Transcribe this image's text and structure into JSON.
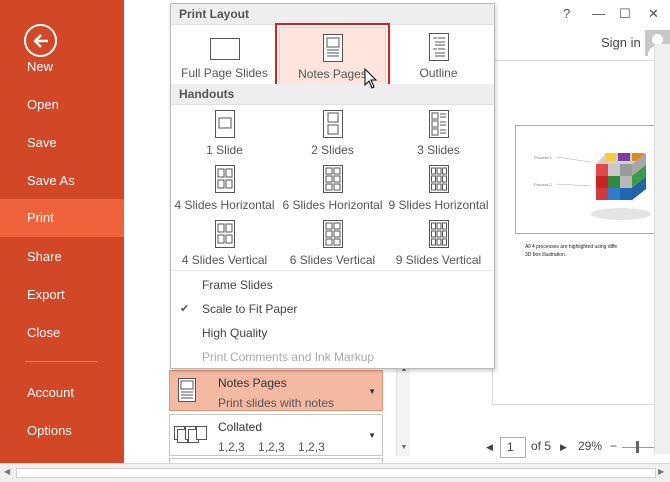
{
  "sidebar": {
    "items": [
      {
        "label": "New"
      },
      {
        "label": "Open"
      },
      {
        "label": "Save"
      },
      {
        "label": "Save As"
      },
      {
        "label": "Print"
      },
      {
        "label": "Share"
      },
      {
        "label": "Export"
      },
      {
        "label": "Close"
      },
      {
        "label": "Account"
      },
      {
        "label": "Options"
      }
    ],
    "active": "Print",
    "accent_color": "#d24726",
    "active_color": "#f0623b"
  },
  "window": {
    "help": "?",
    "minimize": "—",
    "restore": "☐",
    "close": "✕",
    "signin": "Sign in"
  },
  "dropdown": {
    "print_layout_header": "Print Layout",
    "print_layout_options": [
      {
        "label": "Full Page Slides",
        "icon": "full-page-slide-icon"
      },
      {
        "label": "Notes Pages",
        "icon": "notes-pages-icon"
      },
      {
        "label": "Outline",
        "icon": "outline-icon"
      }
    ],
    "handouts_header": "Handouts",
    "handout_options": [
      {
        "label": "1 Slide"
      },
      {
        "label": "2 Slides"
      },
      {
        "label": "3 Slides"
      },
      {
        "label": "4 Slides Horizontal"
      },
      {
        "label": "6 Slides Horizontal"
      },
      {
        "label": "9 Slides Horizontal"
      },
      {
        "label": "4 Slides Vertical"
      },
      {
        "label": "6 Slides Vertical"
      },
      {
        "label": "9 Slides Vertical"
      }
    ],
    "menu_items": [
      {
        "label": "Frame Slides",
        "checked": false,
        "enabled": true
      },
      {
        "label": "Scale to Fit Paper",
        "checked": true,
        "enabled": true
      },
      {
        "label": "High Quality",
        "checked": false,
        "enabled": true
      },
      {
        "label": "Print Comments and Ink Markup",
        "checked": false,
        "enabled": false
      }
    ]
  },
  "settings": {
    "layout": {
      "title": "Notes Pages",
      "subtitle": "Print slides with notes"
    },
    "collate": {
      "title": "Collated",
      "subtitle": "1,2,3    1,2,3    1,2,3"
    }
  },
  "preview": {
    "slide_labels": [
      "Process 1",
      "Process 2"
    ],
    "note_text": "All 4 processes are highlighted using diffe\n3D box illustration."
  },
  "page_nav": {
    "current_page": "1",
    "of_label": "of 5",
    "zoom": "29%"
  }
}
